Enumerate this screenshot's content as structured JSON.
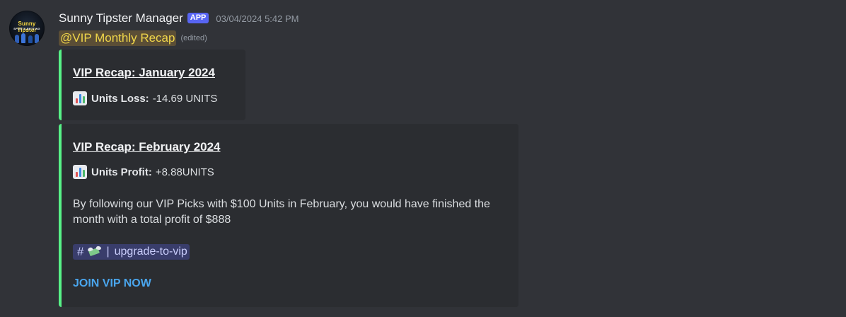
{
  "message": {
    "author": "Sunny Tipster Manager",
    "badge": "APP",
    "timestamp": "03/04/2024 5:42 PM",
    "avatar_brand": "Sunny Tipster",
    "avatar_sub": "SPORTS BETTING",
    "mention": "@VIP Monthly Recap",
    "edited_label": "(edited)"
  },
  "embeds": [
    {
      "title": "VIP Recap: January 2024",
      "stat_icon": "bar-chart-icon",
      "stat_label": "Units Loss:",
      "stat_value": "-14.69 UNITS",
      "accent": "#57f287"
    },
    {
      "title": "VIP Recap: February 2024",
      "stat_icon": "bar-chart-icon",
      "stat_label": "Units Profit:",
      "stat_value": "+8.88UNITS",
      "description": "By following our VIP Picks with $100 Units in February, you would have finished the month with a total profit of $888",
      "channel": {
        "hash": "#",
        "icon": "money-with-wings-icon",
        "separator": "|",
        "name": "upgrade-to-vip"
      },
      "link": "JOIN VIP NOW",
      "accent": "#57f287"
    }
  ],
  "colors": {
    "background": "#313338",
    "embed_bg": "#2b2d31",
    "embed_accent": "#57f287",
    "badge": "#5865f2",
    "link": "#4aa6ee",
    "mention_text": "#f0d64a"
  }
}
